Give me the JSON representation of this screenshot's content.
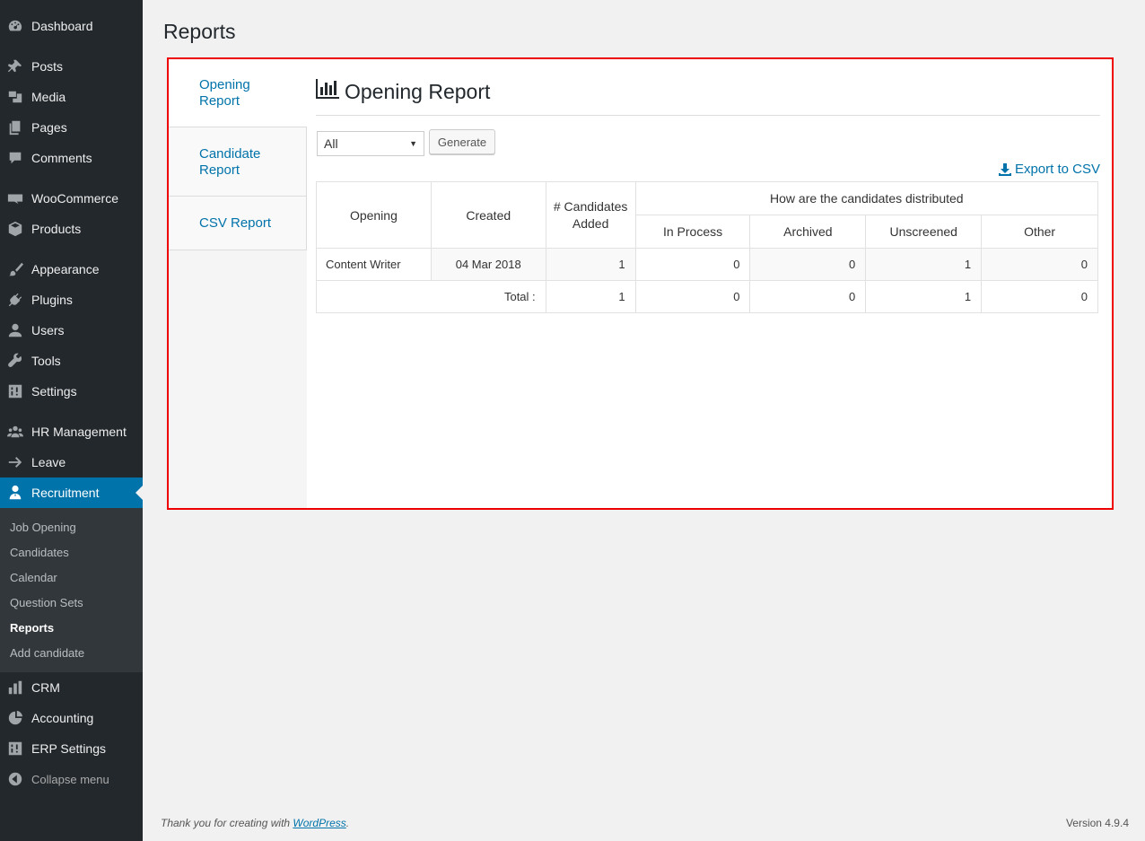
{
  "sidebar": {
    "items": [
      {
        "label": "Dashboard",
        "icon": "dashboard-icon"
      },
      {
        "label": "Posts",
        "icon": "pin-icon"
      },
      {
        "label": "Media",
        "icon": "media-icon"
      },
      {
        "label": "Pages",
        "icon": "pages-icon"
      },
      {
        "label": "Comments",
        "icon": "comment-icon"
      },
      {
        "label": "WooCommerce",
        "icon": "woo-icon"
      },
      {
        "label": "Products",
        "icon": "box-icon"
      },
      {
        "label": "Appearance",
        "icon": "brush-icon"
      },
      {
        "label": "Plugins",
        "icon": "plug-icon"
      },
      {
        "label": "Users",
        "icon": "user-icon"
      },
      {
        "label": "Tools",
        "icon": "wrench-icon"
      },
      {
        "label": "Settings",
        "icon": "settings-icon"
      },
      {
        "label": "HR Management",
        "icon": "groups-icon"
      },
      {
        "label": "Leave",
        "icon": "arrow-right-icon"
      },
      {
        "label": "Recruitment",
        "icon": "businessman-icon"
      },
      {
        "label": "CRM",
        "icon": "chart-bar-icon"
      },
      {
        "label": "Accounting",
        "icon": "chart-pie-icon"
      },
      {
        "label": "ERP Settings",
        "icon": "settings-icon"
      },
      {
        "label": "Collapse menu",
        "icon": "collapse-icon"
      }
    ],
    "submenu": [
      "Job Opening",
      "Candidates",
      "Calendar",
      "Question Sets",
      "Reports",
      "Add candidate"
    ]
  },
  "page": {
    "title": "Reports"
  },
  "tabs": [
    "Opening Report",
    "Candidate Report",
    "CSV Report"
  ],
  "report": {
    "heading": "Opening Report",
    "filter_value": "All",
    "generate_label": "Generate",
    "export_label": "Export to CSV",
    "headers": {
      "opening": "Opening",
      "created": "Created",
      "candidates_added": "# Candidates Added",
      "distribution": "How are the candidates distributed",
      "in_process": "In Process",
      "archived": "Archived",
      "unscreened": "Unscreened",
      "other": "Other"
    },
    "rows": [
      {
        "opening": "Content Writer",
        "created": "04 Mar 2018",
        "added": "1",
        "in_process": "0",
        "archived": "0",
        "unscreened": "1",
        "other": "0"
      }
    ],
    "total": {
      "label": "Total :",
      "added": "1",
      "in_process": "0",
      "archived": "0",
      "unscreened": "1",
      "other": "0"
    }
  },
  "footer": {
    "thanks_prefix": "Thank you for creating with ",
    "thanks_link": "WordPress",
    "thanks_suffix": ".",
    "version": "Version 4.9.4"
  },
  "colors": {
    "accent": "#0073aa",
    "sidebar": "#23282d",
    "highlight_border": "#ee0000"
  }
}
